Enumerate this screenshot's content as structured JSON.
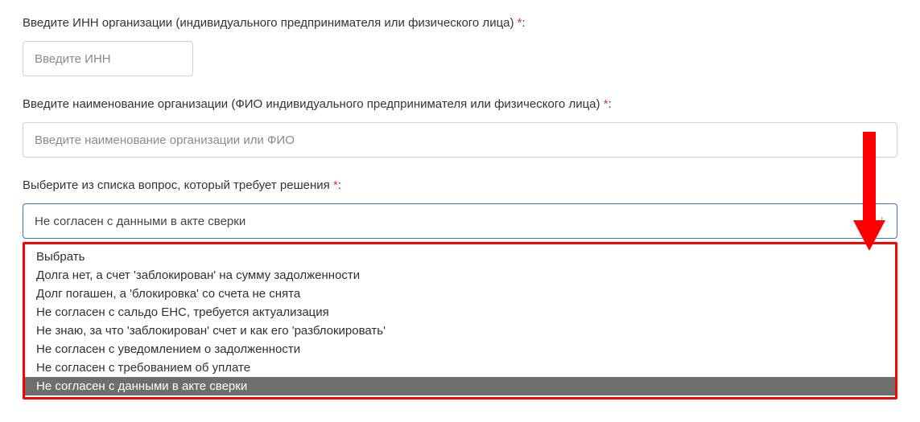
{
  "fields": {
    "inn": {
      "label": "Введите ИНН организации (индивидуального предпринимателя или физического лица)",
      "required_mark": "*",
      "colon": ":",
      "placeholder": "Введите ИНН"
    },
    "org_name": {
      "label": "Введите наименование организации (ФИО индивидуального предпринимателя или физического лица)",
      "required_mark": "*",
      "colon": ":",
      "placeholder": "Введите наименование организации или ФИО"
    },
    "question": {
      "label": "Выберите из списка вопрос, который требует решения",
      "required_mark": "*",
      "colon": ":",
      "selected": "Не согласен с данными в акте сверки",
      "options": [
        "Выбрать",
        "Долга нет, а счет 'заблокирован' на сумму задолженности",
        "Долг погашен, а 'блокировка' со счета не снята",
        "Не согласен с сальдо ЕНС, требуется актуализация",
        "Не знаю, за что 'заблокирован' счет и как его 'разблокировать'",
        "Не согласен с уведомлением о задолженности",
        "Не согласен с требованием об уплате",
        "Не согласен с данными в акте сверки"
      ],
      "selected_index": 7
    }
  }
}
